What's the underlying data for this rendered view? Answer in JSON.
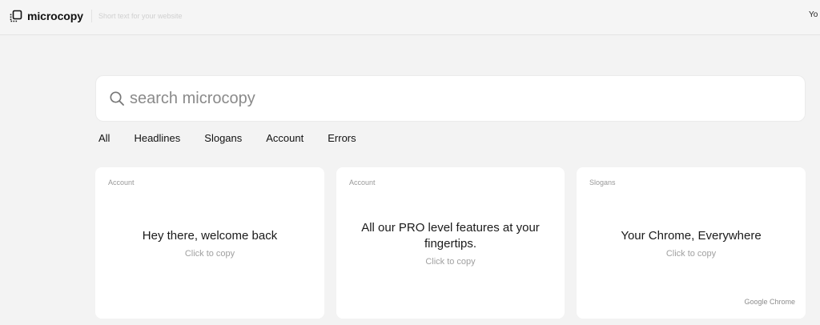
{
  "header": {
    "brand": "microcopy",
    "tagline": "Short text for your website",
    "user_label": "Yo"
  },
  "search": {
    "placeholder": "search microcopy",
    "value": ""
  },
  "tabs": [
    {
      "label": "All"
    },
    {
      "label": "Headlines"
    },
    {
      "label": "Slogans"
    },
    {
      "label": "Account"
    },
    {
      "label": "Errors"
    }
  ],
  "cards": [
    {
      "category": "Account",
      "text": "Hey there, welcome back",
      "hint": "Click to copy",
      "source": ""
    },
    {
      "category": "Account",
      "text": "All our PRO level features at your fingertips.",
      "hint": "Click to copy",
      "source": ""
    },
    {
      "category": "Slogans",
      "text": "Your Chrome, Everywhere",
      "hint": "Click to copy",
      "source": "Google Chrome"
    }
  ],
  "icons": {
    "logo": "microcopy-logo-icon",
    "search": "search-icon"
  },
  "colors": {
    "background": "#f3f3f3",
    "card": "#ffffff",
    "text": "#1a1a1a",
    "muted": "#a0a0a0"
  }
}
